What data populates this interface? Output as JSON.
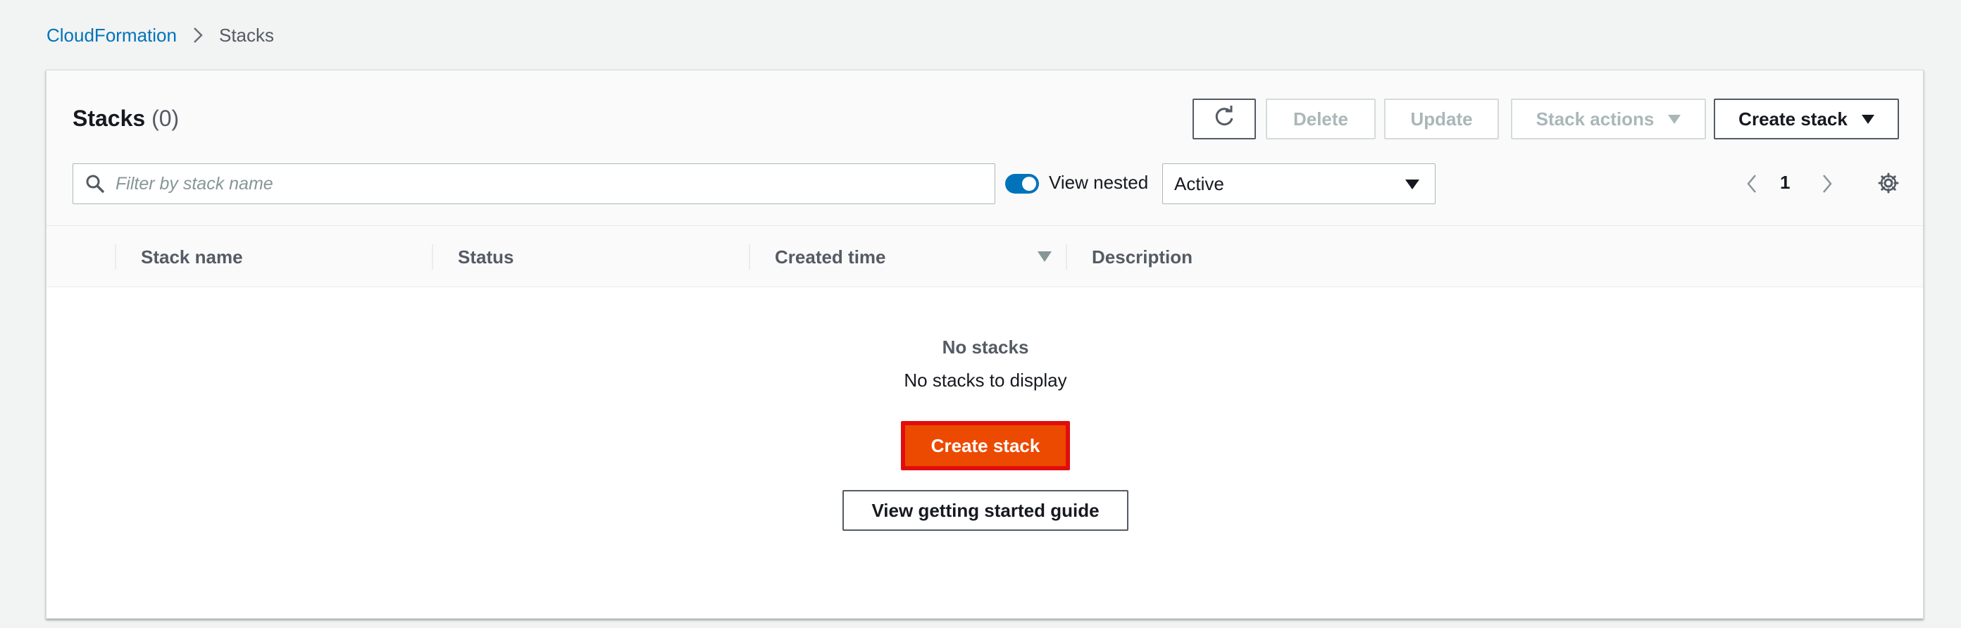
{
  "breadcrumb": {
    "items": [
      "CloudFormation",
      "Stacks"
    ]
  },
  "stacks_panel": {
    "title": "Stacks",
    "count": "(0)",
    "buttons": {
      "refresh_icon": "refresh-icon",
      "delete": "Delete",
      "update": "Update",
      "stack_actions": "Stack actions",
      "create_stack": "Create stack"
    },
    "filter": {
      "placeholder": "Filter by stack name",
      "value": ""
    },
    "view_nested": {
      "label": "View nested",
      "enabled": true
    },
    "status_filter": {
      "selected": "Active"
    },
    "pagination": {
      "current_page": "1"
    },
    "table": {
      "columns": [
        "Stack name",
        "Status",
        "Created time",
        "Description"
      ],
      "sorted_column": "Created time",
      "sort_direction": "descending",
      "rows": []
    },
    "empty_state": {
      "title": "No stacks",
      "description": "No stacks to display",
      "primary_action": "Create stack",
      "secondary_action": "View getting started guide"
    }
  },
  "colors": {
    "link": "#0073bb",
    "primary_button": "#ec4a00",
    "highlight_border": "#e10d0d",
    "toggle_on": "#0073bb",
    "background": "#f2f3f3"
  }
}
